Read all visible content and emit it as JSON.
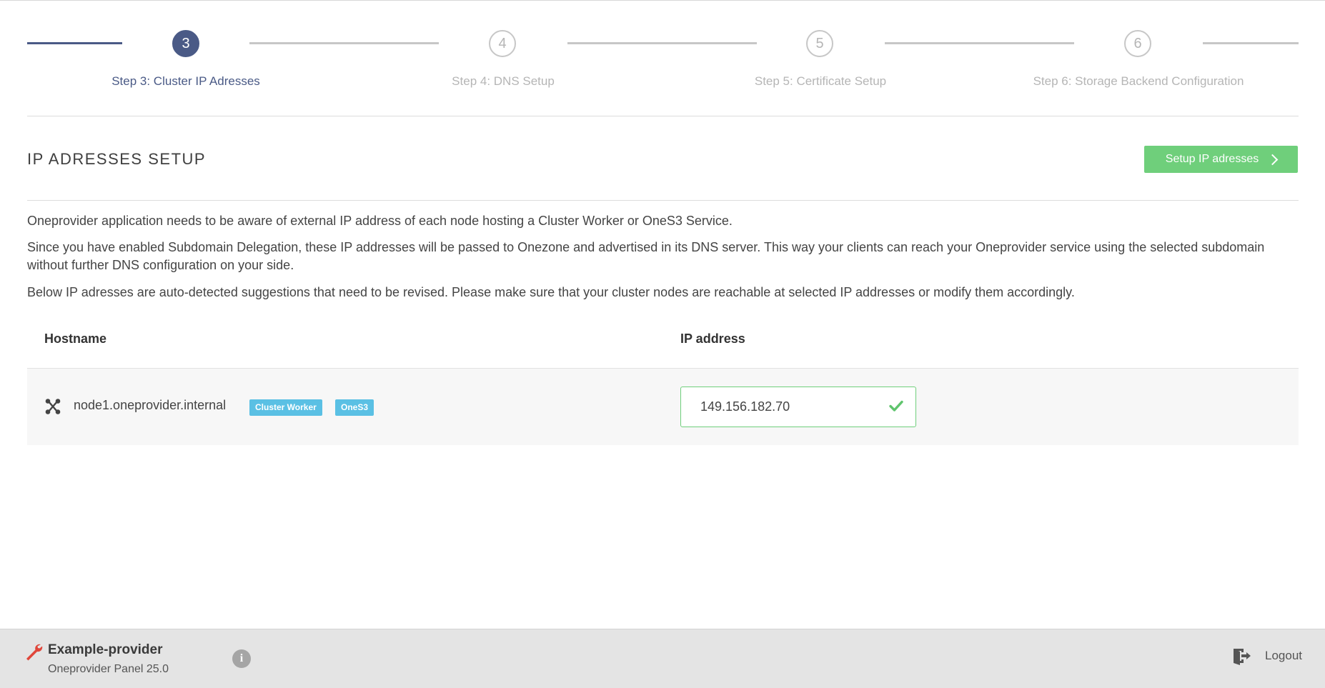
{
  "stepper": {
    "current": 3,
    "steps": [
      {
        "number": "3",
        "label": "Step 3: Cluster IP Adresses",
        "state": "active"
      },
      {
        "number": "4",
        "label": "Step 4: DNS Setup",
        "state": "pending"
      },
      {
        "number": "5",
        "label": "Step 5: Certificate Setup",
        "state": "pending"
      },
      {
        "number": "6",
        "label": "Step 6: Storage Backend Configuration",
        "state": "pending"
      }
    ]
  },
  "page": {
    "title": "IP ADRESSES SETUP",
    "setup_button_label": "Setup IP adresses",
    "paragraphs": [
      "Oneprovider application needs to be aware of external IP address of each node hosting a Cluster Worker or OneS3 Service.",
      "Since you have enabled Subdomain Delegation, these IP addresses will be passed to Onezone and advertised in its DNS server. This way your clients can reach your Oneprovider service using the selected subdomain without further DNS configuration on your side.",
      "Below IP adresses are auto-detected suggestions that need to be revised. Please make sure that your cluster nodes are reachable at selected IP addresses or modify them accordingly."
    ]
  },
  "table": {
    "columns": [
      "Hostname",
      "IP address"
    ],
    "rows": [
      {
        "icon": "node-icon",
        "hostname": "node1.oneprovider.internal",
        "badges": [
          "Cluster Worker",
          "OneS3"
        ],
        "ip": "149.156.182.70",
        "ip_valid": true
      }
    ]
  },
  "footer": {
    "provider_name": "Example-provider",
    "panel_version": "Oneprovider Panel 25.0",
    "logout_label": "Logout"
  },
  "colors": {
    "accent": "#4a5a86",
    "success": "#6fcf7b",
    "badge": "#5ac0e4",
    "wrench": "#e0463a"
  }
}
